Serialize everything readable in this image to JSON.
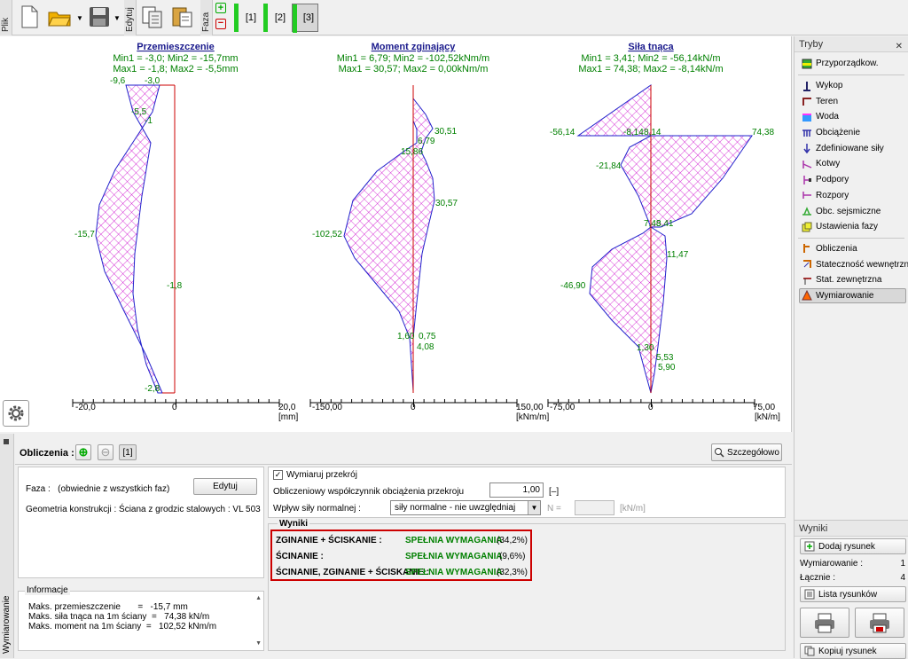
{
  "toolbar": {
    "tab_plik": "Plik",
    "tab_edytuj": "Edytuj",
    "tab_faza": "Faza",
    "phases": [
      "[1]",
      "[2]",
      "[3]"
    ]
  },
  "diagrams": [
    {
      "title": "Przemieszczenie",
      "line1": "Min1 = -3,0; Min2 = -15,7mm",
      "line2": "Max1 = -1,8; Max2 = -5,5mm",
      "labels": [
        "-9,6",
        "-3,0",
        "-5,5",
        "-1",
        "-15,7",
        "-1,8",
        "-2,8"
      ],
      "ticks": [
        "-20,0",
        "0",
        "20,0"
      ],
      "unit": "[mm]"
    },
    {
      "title": "Moment zginający",
      "line1": "Min1 = 6,79; Min2 = -102,52kNm/m",
      "line2": "Max1 = 30,57; Max2 = 0,00kNm/m",
      "labels": [
        "30,51",
        "6,79",
        "15,86",
        "30,57",
        "-102,52",
        "1,60",
        "0,75",
        "4,08"
      ],
      "ticks": [
        "-150,00",
        "0",
        "150,00"
      ],
      "unit": "[kNm/m]"
    },
    {
      "title": "Siła tnąca",
      "line1": "Min1 = 3,41; Min2 = -56,14kN/m",
      "line2": "Max1 = 74,38; Max2 = -8,14kN/m",
      "labels": [
        "-56,14",
        "-8,14",
        "8,14",
        "74,38",
        "-21,84",
        "7,48",
        "3,41",
        "11,47",
        "-46,90",
        "1,30",
        "5,53",
        "5,90"
      ],
      "ticks": [
        "-75,00",
        "0",
        "75,00"
      ],
      "unit": "[kN/m]"
    }
  ],
  "sidebar": {
    "title": "Tryby",
    "items": [
      {
        "label": "Przyporządkow."
      },
      {
        "label": "Wykop"
      },
      {
        "label": "Teren"
      },
      {
        "label": "Woda"
      },
      {
        "label": "Obciążenie"
      },
      {
        "label": "Zdefiniowane siły"
      },
      {
        "label": "Kotwy"
      },
      {
        "label": "Podpory"
      },
      {
        "label": "Rozpory"
      },
      {
        "label": "Obc. sejsmiczne"
      },
      {
        "label": "Ustawienia fazy"
      },
      {
        "label": "Obliczenia"
      },
      {
        "label": "Stateczność wewnętrzna"
      },
      {
        "label": "Stat. zewnętrzna"
      },
      {
        "label": "Wymiarowanie"
      }
    ],
    "results": {
      "title": "Wyniki",
      "add_drawing": "Dodaj rysunek",
      "dim_label": "Wymiarowanie :",
      "dim_value": "1",
      "total_label": "Łącznie :",
      "total_value": "4",
      "list_drawings": "Lista rysunków",
      "copy_drawing": "Kopiuj rysunek"
    }
  },
  "bottom": {
    "side_tab": "Wymiarowanie",
    "calc_label": "Obliczenia :",
    "calc_index": "[1]",
    "details_button": "Szczegółowo",
    "faza_label": "Faza :",
    "faza_value": "(obwiednie z wszystkich faz)",
    "edit_button": "Edytuj",
    "geometry": "Geometria konstrukcji : Ściana z grodzic stalowych : VL 503",
    "info_title": "Informacje",
    "info_lines": [
      "Maks. przemieszczenie       =   -15,7 mm",
      "Maks. siła tnąca na 1m ściany  =   74,38 kN/m",
      "Maks. moment na 1m ściany  =   102,52 kNm/m"
    ],
    "check_label": "Wymiaruj przekrój",
    "coef_label": "Obliczeniowy współczynnik obciążenia przekroju",
    "coef_value": "1,00",
    "coef_unit": "[–]",
    "normal_label": "Wpływ siły normalnej :",
    "normal_value": "siły normalne - nie uwzględniaj",
    "n_label": "N =",
    "n_unit": "[kN/m]",
    "results_title": "Wyniki",
    "results": [
      {
        "name": "ZGINANIE + ŚCISKANIE :",
        "status": "SPEŁNIA WYMAGANIA",
        "value": "(34,2%)"
      },
      {
        "name": "ŚCINANIE :",
        "status": "SPEŁNIA WYMAGANIA",
        "value": "(9,6%)"
      },
      {
        "name": "ŚCINANIE, ZGINANIE + ŚCISKANIE :",
        "status": "SPEŁNIA WYMAGANIA",
        "value": "(32,3%)"
      }
    ]
  },
  "colors": {
    "hatch": "#cc00cc",
    "outline": "#2222cc",
    "axis": "#cc0000",
    "label": "#008000",
    "result_border": "#cc0000",
    "phase_bar": "#22cc22"
  }
}
